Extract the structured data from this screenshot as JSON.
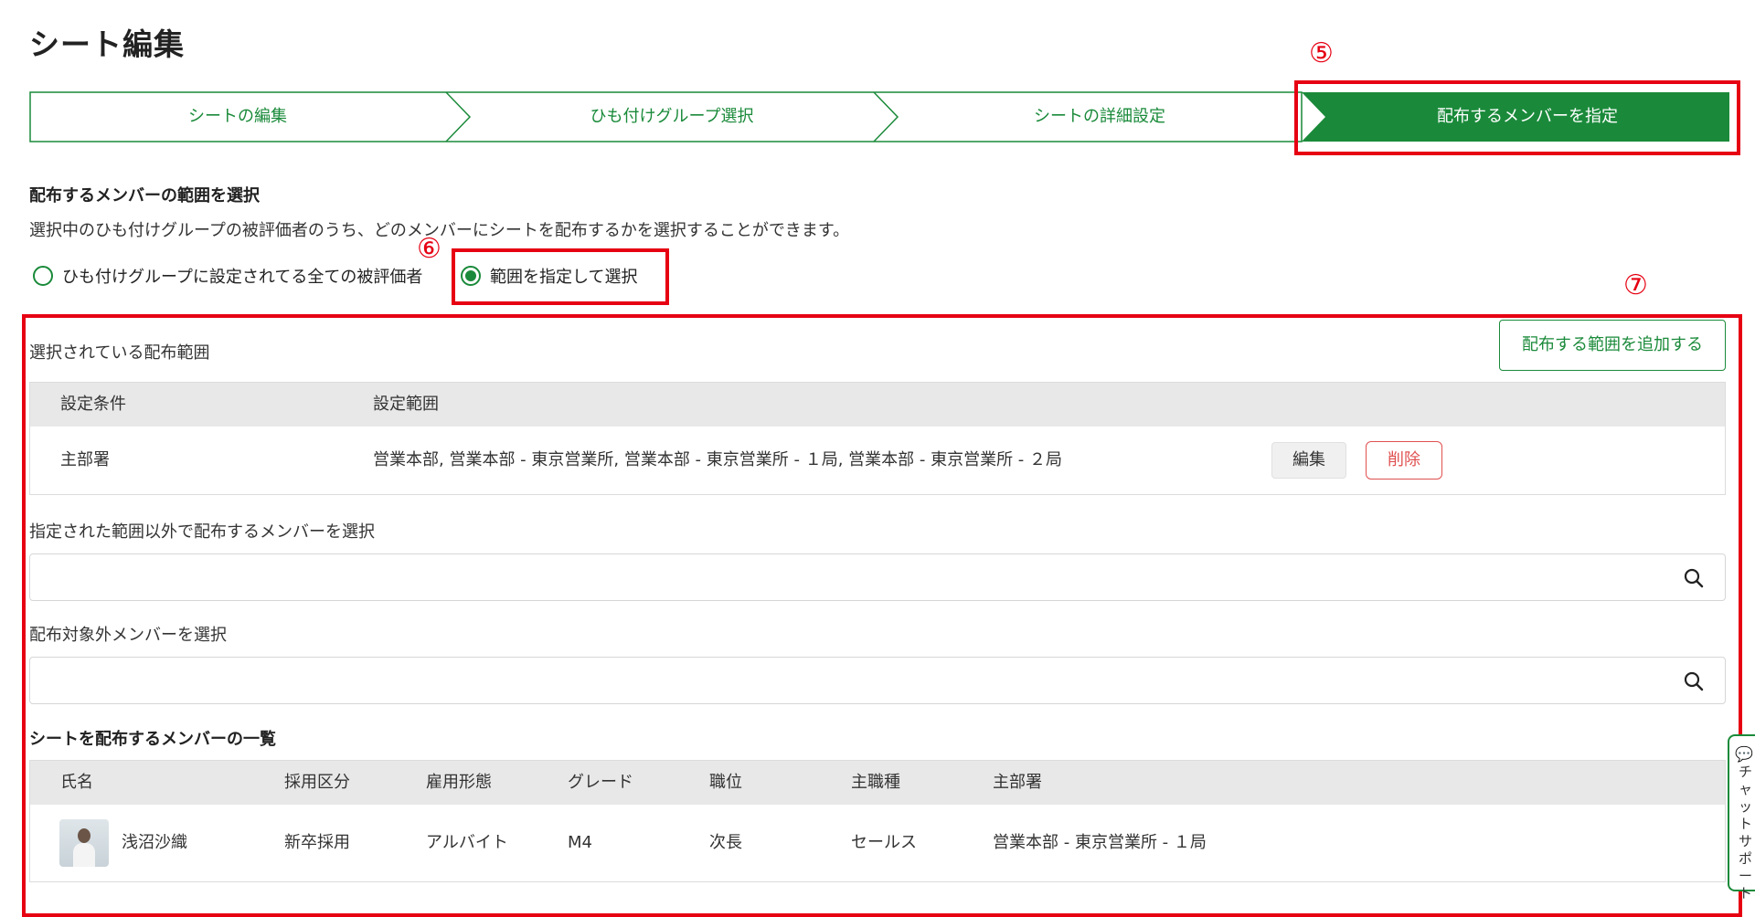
{
  "page": {
    "title": "シート編集"
  },
  "stepper": {
    "steps": [
      {
        "label": "シートの編集",
        "active": false
      },
      {
        "label": "ひも付けグループ選択",
        "active": false
      },
      {
        "label": "シートの詳細設定",
        "active": false
      },
      {
        "label": "配布するメンバーを指定",
        "active": true
      }
    ],
    "accent": "#1a8a3a"
  },
  "annotations": {
    "n5": "⑤",
    "n6": "⑥",
    "n7": "⑦",
    "color": "#e60012"
  },
  "section": {
    "title": "配布するメンバーの範囲を選択",
    "description": "選択中のひも付けグループの被評価者のうち、どのメンバーにシートを配布するかを選択することができます。"
  },
  "radios": {
    "all_label": "ひも付けグループに設定されてる全ての被評価者",
    "range_label": "範囲を指定して選択",
    "selected": "range"
  },
  "range": {
    "label": "選択されている配布範囲",
    "add_button": "配布する範囲を追加する",
    "headers": {
      "condition": "設定条件",
      "scope": "設定範囲"
    },
    "rows": [
      {
        "condition": "主部署",
        "scope": "営業本部, 営業本部 - 東京営業所, 営業本部 - 東京営業所 - １局, 営業本部 - 東京営業所 - ２局",
        "edit": "編集",
        "delete": "削除"
      }
    ]
  },
  "extra_members": {
    "label": "指定された範囲以外で配布するメンバーを選択",
    "value": ""
  },
  "excluded_members": {
    "label": "配布対象外メンバーを選択",
    "value": ""
  },
  "members": {
    "title": "シートを配布するメンバーの一覧",
    "headers": [
      "氏名",
      "採用区分",
      "雇用形態",
      "グレード",
      "職位",
      "主職種",
      "主部署"
    ],
    "rows": [
      {
        "name": "浅沼沙織",
        "hire_type": "新卒採用",
        "employment": "アルバイト",
        "grade": "M4",
        "position": "次長",
        "job": "セールス",
        "dept": "営業本部 - 東京営業所 - １局"
      }
    ]
  },
  "chat": {
    "icon": "chat-icon",
    "label": "チャットサポート"
  }
}
